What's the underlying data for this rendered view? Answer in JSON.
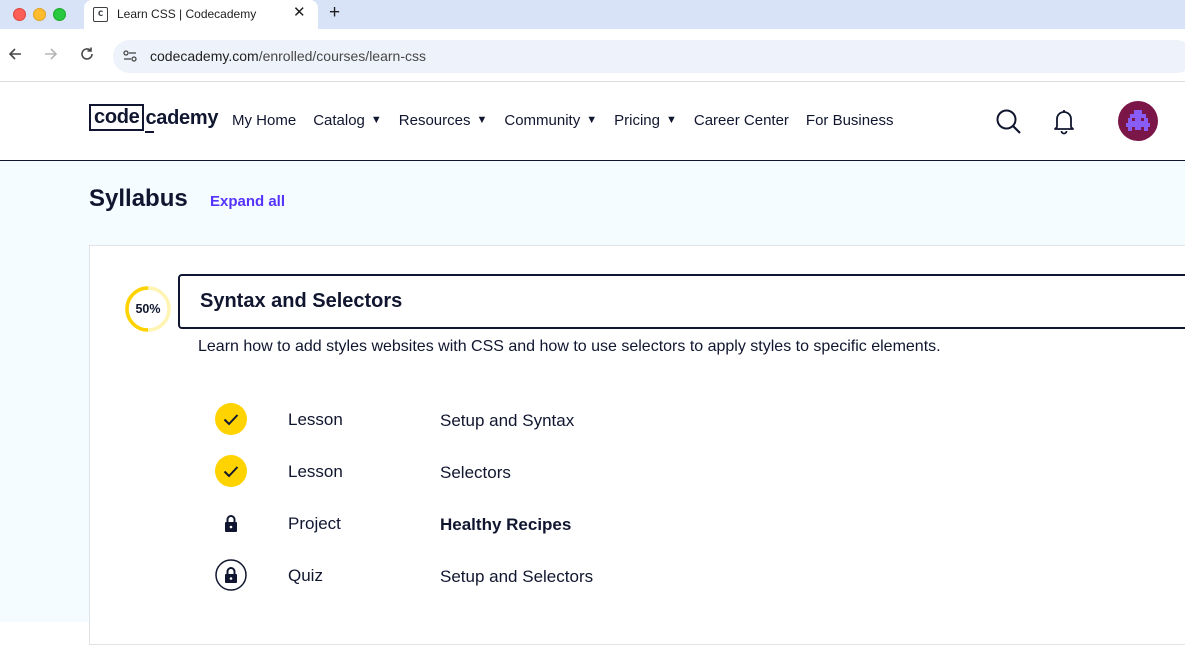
{
  "browser": {
    "tab_title": "Learn CSS | Codecademy",
    "tab_close": "✕",
    "new_tab": "+",
    "url_host": "codecademy.com",
    "url_path": "/enrolled/courses/learn-css"
  },
  "header": {
    "logo_box": "code",
    "logo_rest": "cademy",
    "nav": [
      {
        "label": "My Home",
        "dropdown": false
      },
      {
        "label": "Catalog",
        "dropdown": true
      },
      {
        "label": "Resources",
        "dropdown": true
      },
      {
        "label": "Community",
        "dropdown": true
      },
      {
        "label": "Pricing",
        "dropdown": true
      },
      {
        "label": "Career Center",
        "dropdown": false
      },
      {
        "label": "For Business",
        "dropdown": false
      }
    ],
    "caret": "▼"
  },
  "syllabus": {
    "title": "Syllabus",
    "expand_all": "Expand all",
    "module": {
      "progress_label": "50%",
      "progress_fraction": 0.5,
      "title": "Syntax and Selectors",
      "description": "Learn how to add styles websites with CSS and how to use selectors to apply styles to specific elements.",
      "items": [
        {
          "type": "Lesson",
          "name": "Setup and Syntax",
          "status": "completed",
          "icon": "check-icon"
        },
        {
          "type": "Lesson",
          "name": "Selectors",
          "status": "completed",
          "icon": "check-icon"
        },
        {
          "type": "Project",
          "name": "Healthy Recipes",
          "status": "locked",
          "icon": "lock-icon"
        },
        {
          "type": "Quiz",
          "name": "Setup and Selectors",
          "status": "locked",
          "icon": "lock-circle-icon"
        }
      ]
    }
  },
  "colors": {
    "accent": "#5533ff",
    "completed": "#ffd300",
    "navy": "#10162f",
    "avatar_bg": "#7b1648",
    "avatar_fg": "#8a5cf6"
  }
}
